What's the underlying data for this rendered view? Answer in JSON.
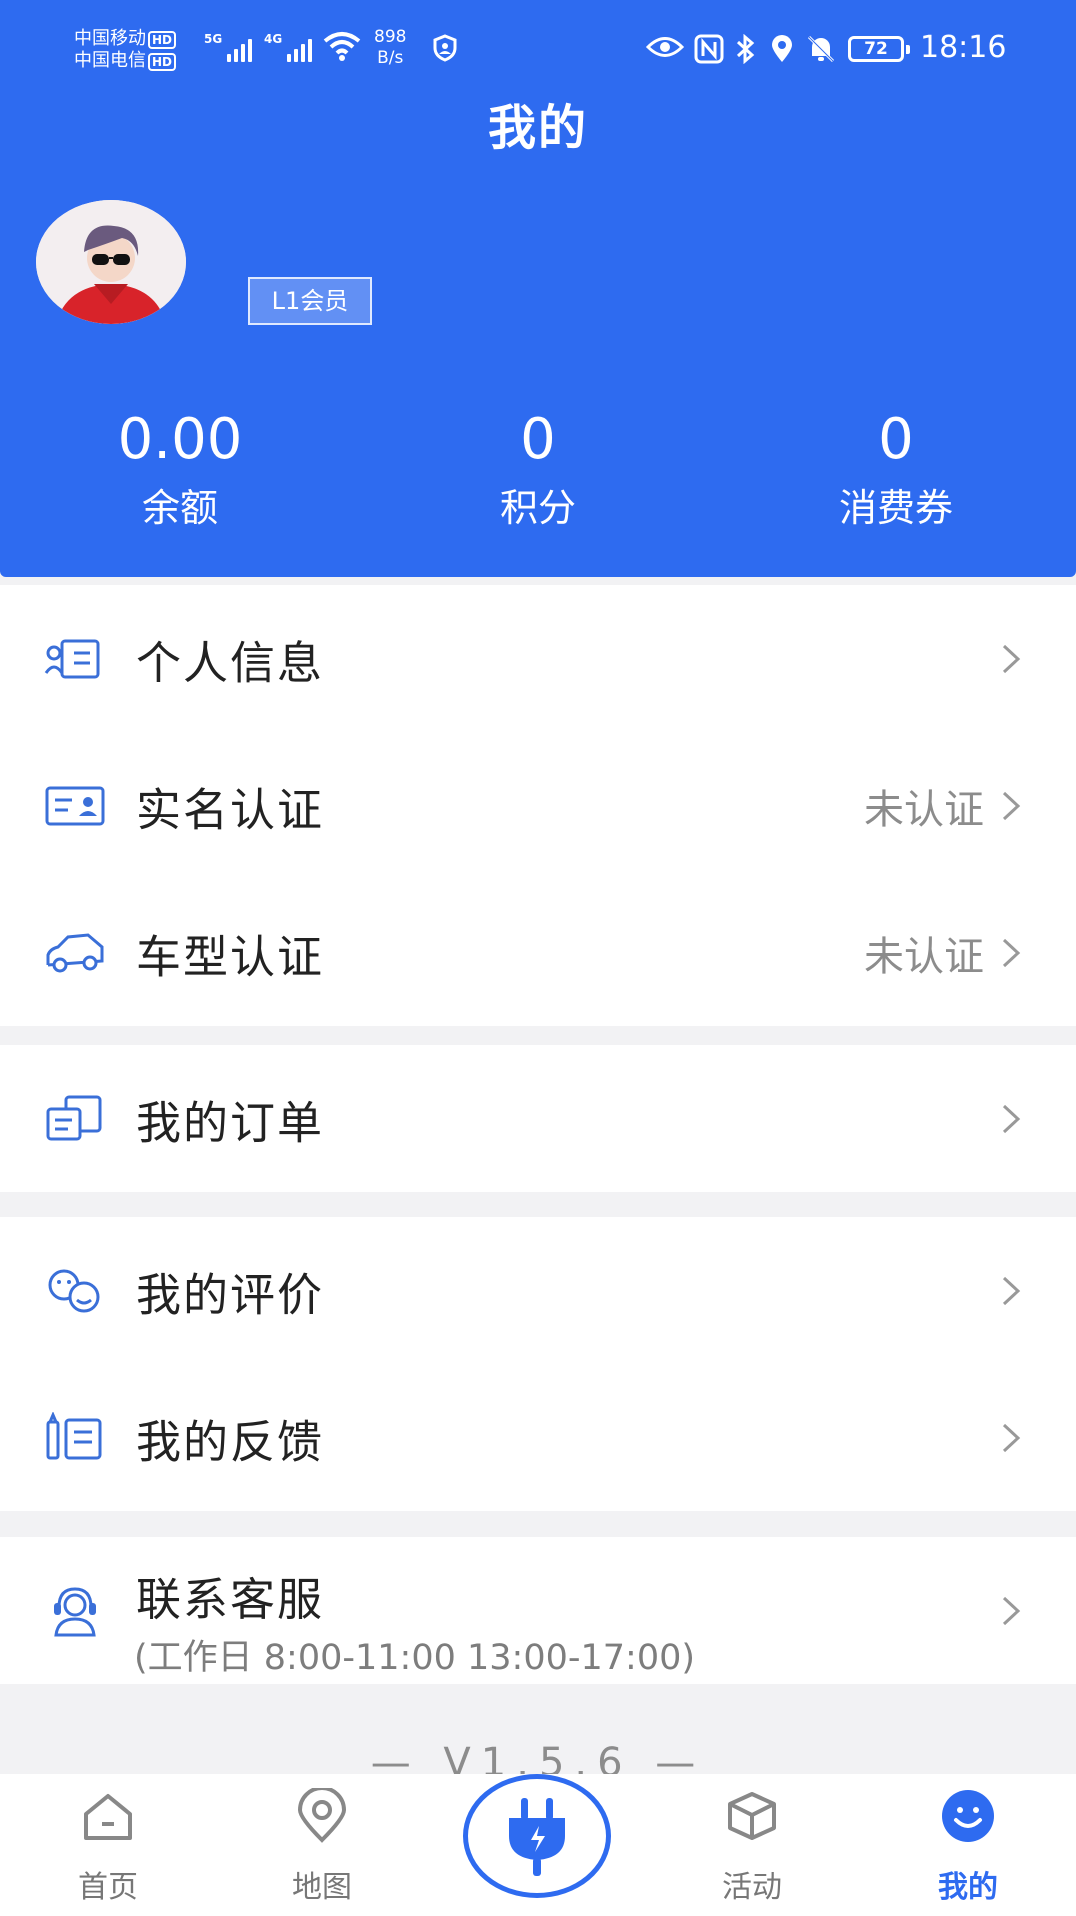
{
  "status_bar": {
    "carrier_1": "中国移动",
    "carrier_2": "中国电信",
    "hd_badge": "HD",
    "signal_1_tag": "5G",
    "signal_2_tag": "4G",
    "net_speed_value": "898",
    "net_speed_unit": "B/s",
    "battery": "72",
    "time": "18:16"
  },
  "header": {
    "title": "我的",
    "member_level": "L1会员"
  },
  "stats": [
    {
      "value": "0.00",
      "label": "余额"
    },
    {
      "value": "0",
      "label": "积分"
    },
    {
      "value": "0",
      "label": "消费券"
    }
  ],
  "menu": {
    "profile": {
      "label": "个人信息",
      "icon": "profile-icon"
    },
    "realname": {
      "label": "实名认证",
      "status": "未认证",
      "icon": "id-card-icon"
    },
    "vehicle": {
      "label": "车型认证",
      "status": "未认证",
      "icon": "car-icon"
    },
    "orders": {
      "label": "我的订单",
      "icon": "orders-icon"
    },
    "reviews": {
      "label": "我的评价",
      "icon": "reviews-icon"
    },
    "feedback": {
      "label": "我的反馈",
      "icon": "feedback-icon"
    },
    "service": {
      "label": "联系客服",
      "hours": "(工作日 8:00-11:00 13:00-17:00)",
      "icon": "headset-icon"
    }
  },
  "version": "— V1.5.6 —",
  "tabbar": {
    "home": "首页",
    "map": "地图",
    "activity": "活动",
    "mine": "我的"
  },
  "colors": {
    "brand": "#2e6bf0",
    "icon": "#3a6fd8",
    "muted": "#8c8c8c"
  }
}
